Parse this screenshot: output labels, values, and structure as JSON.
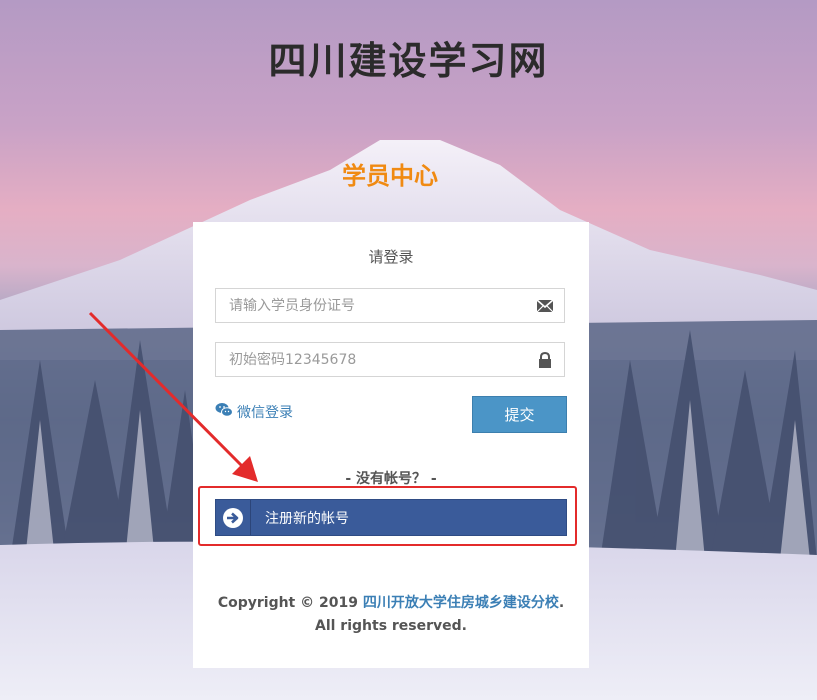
{
  "site": {
    "title": "四川建设学习网",
    "subtitle": "学员中心"
  },
  "login": {
    "prompt": "请登录",
    "id_placeholder": "请输入学员身份证号",
    "password_placeholder": "初始密码12345678",
    "wechat_label": "微信登录",
    "submit_label": "提交",
    "no_account_text": "- 没有帐号？ -",
    "register_label": "注册新的帐号"
  },
  "footer": {
    "copyright_prefix": "Copyright © 2019 ",
    "org_link": "四川开放大学住房城乡建设分校",
    "suffix": ".",
    "rights": "All rights reserved."
  },
  "colors": {
    "accent_orange": "#f08a12",
    "submit_blue": "#4b95c7",
    "register_blue": "#3a5b9a",
    "highlight_red": "#e32b2b",
    "link_blue": "#3b7fb5"
  },
  "icons": [
    "envelope-icon",
    "lock-icon",
    "wechat-icon",
    "arrow-circle-right-icon"
  ]
}
